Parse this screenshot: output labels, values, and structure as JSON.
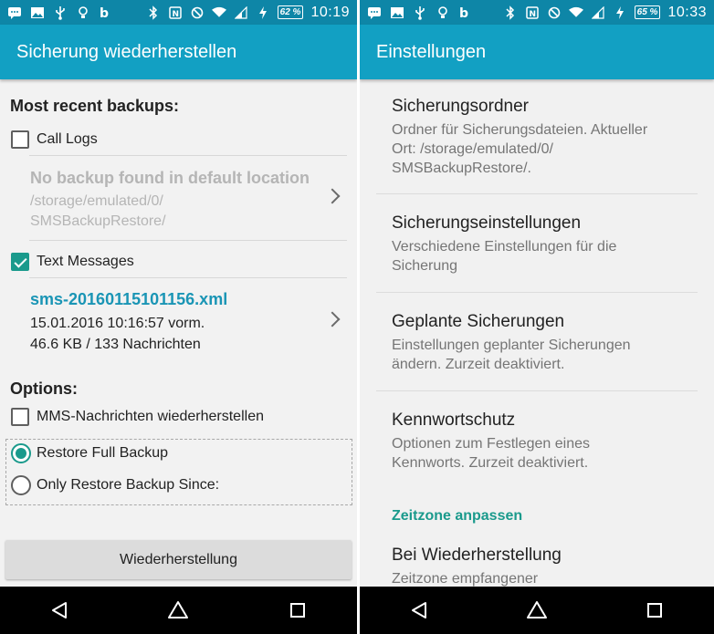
{
  "status_left": {
    "time": "10:19",
    "battery": "62 %"
  },
  "status_right": {
    "time": "10:33",
    "battery": "65 %"
  },
  "left": {
    "title": "Sicherung wiederherstellen",
    "recent_heading": "Most recent backups:",
    "call_logs": {
      "label": "Call Logs",
      "checked": false,
      "message": "No backup found in default location",
      "path_line1": "/storage/emulated/0/",
      "path_line2": "SMSBackupRestore/"
    },
    "text_messages": {
      "label": "Text Messages",
      "checked": true,
      "file": "sms-20160115101156.xml",
      "date": "15.01.2016 10:16:57 vorm.",
      "size": "46.6 KB / 133 Nachrichten"
    },
    "options_heading": "Options:",
    "mms_label": "MMS-Nachrichten wiederherstellen",
    "radio_full": "Restore Full Backup",
    "radio_since": "Only Restore Backup Since:",
    "restore_button": "Wiederherstellung"
  },
  "right": {
    "title": "Einstellungen",
    "items": [
      {
        "title": "Sicherungsordner",
        "summary_line1": "Ordner für Sicherungsdateien. Aktueller",
        "summary_line2": "Ort: /storage/emulated/0/",
        "summary_line3": "SMSBackupRestore/."
      },
      {
        "title": "Sicherungseinstellungen",
        "summary_line1": "Verschiedene Einstellungen für die",
        "summary_line2": "Sicherung"
      },
      {
        "title": "Geplante Sicherungen",
        "summary_line1": "Einstellungen geplanter Sicherungen",
        "summary_line2": "ändern. Zurzeit deaktiviert."
      },
      {
        "title": "Kennwortschutz",
        "summary_line1": "Optionen zum Festlegen eines",
        "summary_line2": "Kennworts. Zurzeit deaktiviert."
      }
    ],
    "category": "Zeitzone anpassen",
    "last_item": {
      "title": "Bei Wiederherstellung",
      "summary_line1": "Zeitzone empfangener"
    }
  },
  "icons": {
    "status": [
      "message-icon",
      "image-icon",
      "usb-icon",
      "bulb-icon",
      "app-icon",
      "bluetooth-icon",
      "nfc-icon",
      "dnd-icon",
      "wifi-icon",
      "signal-icon",
      "charging-icon"
    ],
    "nav": [
      "back-icon",
      "home-icon",
      "recents-icon"
    ]
  },
  "colors": {
    "appbar": "#12a0c3",
    "statusbar": "#0e86a7",
    "accent": "#1a9a8c",
    "link": "#1a95b5"
  }
}
